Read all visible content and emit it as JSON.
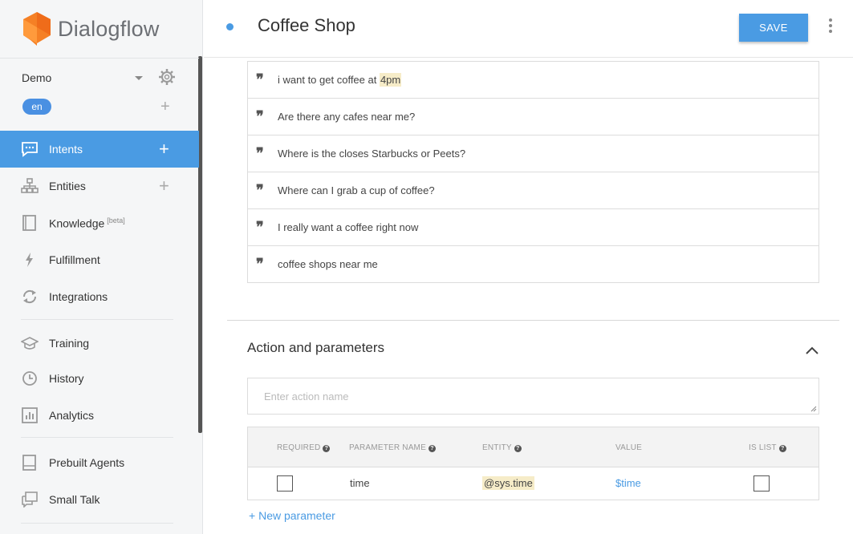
{
  "app": {
    "name": "Dialogflow",
    "brand_color": "#f58025",
    "accent_color": "#4a9be3"
  },
  "sidebar": {
    "agent": {
      "name": "Demo",
      "language": "en"
    },
    "items": [
      {
        "label": "Intents",
        "icon": "chat-icon",
        "active": true,
        "has_add": true
      },
      {
        "label": "Entities",
        "icon": "hierarchy-icon",
        "active": false,
        "has_add": true
      },
      {
        "label": "Knowledge",
        "badge": "[beta]",
        "icon": "book-icon",
        "active": false
      },
      {
        "label": "Fulfillment",
        "icon": "lightning-icon",
        "active": false
      },
      {
        "label": "Integrations",
        "icon": "sync-icon",
        "active": false
      },
      {
        "label": "Training",
        "icon": "graduation-cap-icon",
        "active": false
      },
      {
        "label": "History",
        "icon": "clock-icon",
        "active": false
      },
      {
        "label": "Analytics",
        "icon": "bar-chart-icon",
        "active": false
      },
      {
        "label": "Prebuilt Agents",
        "icon": "book-icon",
        "active": false
      },
      {
        "label": "Small Talk",
        "icon": "chat-bubbles-icon",
        "active": false
      }
    ]
  },
  "header": {
    "title": "Coffee Shop",
    "save_label": "SAVE"
  },
  "training_phrases": [
    {
      "before": "i want to get coffee at ",
      "highlight": "4pm",
      "after": ""
    },
    {
      "before": "Are there any cafes near me?",
      "highlight": "",
      "after": ""
    },
    {
      "before": "Where is the closes Starbucks or Peets?",
      "highlight": "",
      "after": ""
    },
    {
      "before": "Where can I grab a cup of coffee?",
      "highlight": "",
      "after": ""
    },
    {
      "before": "I really want a coffee right now",
      "highlight": "",
      "after": ""
    },
    {
      "before": "coffee shops near me",
      "highlight": "",
      "after": ""
    }
  ],
  "action_section": {
    "title": "Action and parameters",
    "action_placeholder": "Enter action name",
    "columns": {
      "required": "REQUIRED",
      "parameter_name": "PARAMETER NAME",
      "entity": "ENTITY",
      "value": "VALUE",
      "is_list": "IS LIST"
    },
    "rows": [
      {
        "required": false,
        "parameter_name": "time",
        "entity": "@sys.time",
        "value": "$time",
        "is_list": false
      }
    ],
    "new_parameter_label": "New parameter"
  }
}
